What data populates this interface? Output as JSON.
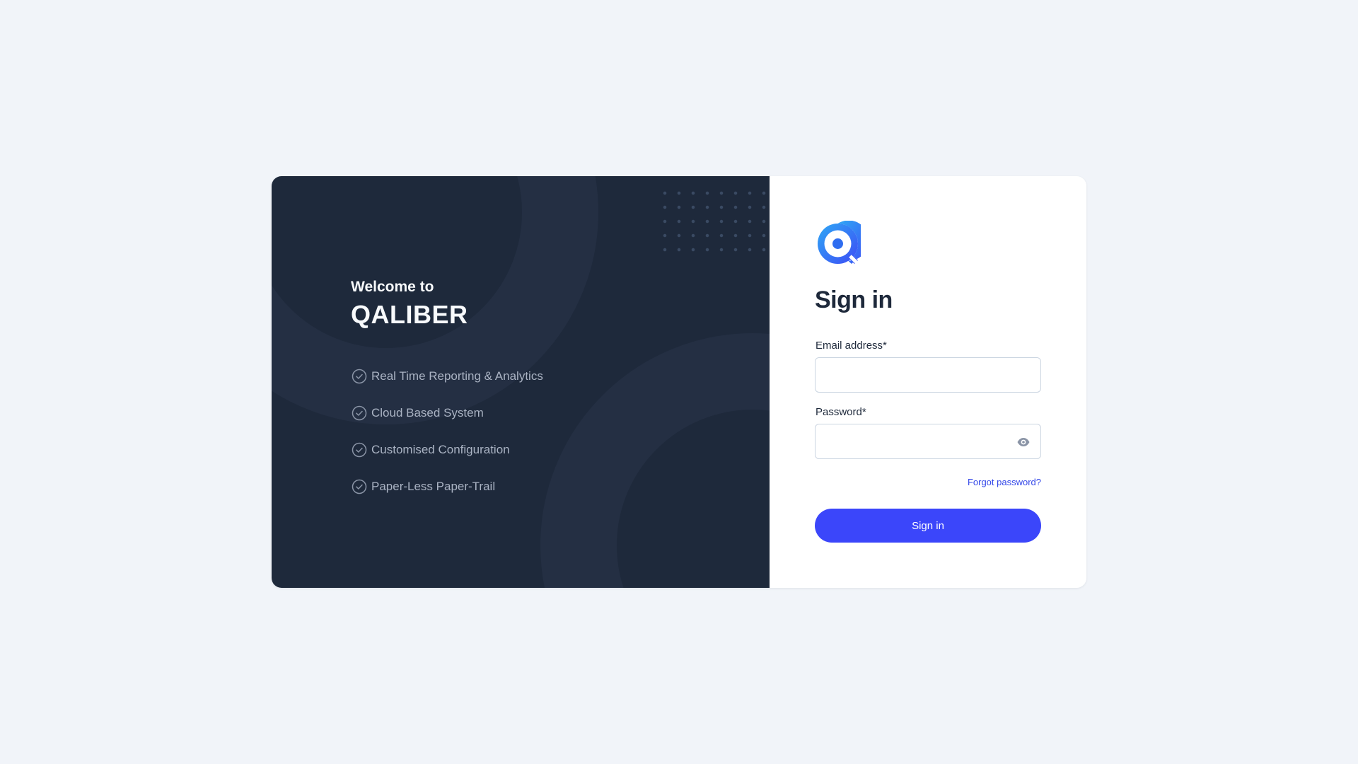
{
  "branding": {
    "welcome_subtitle": "Welcome to",
    "product_name": "QALIBER",
    "logo_icon": "qaliber-logo-icon"
  },
  "features": [
    {
      "label": "Real Time Reporting & Analytics",
      "icon": "check-circle-icon"
    },
    {
      "label": "Cloud Based System",
      "icon": "check-circle-icon"
    },
    {
      "label": "Customised Configuration",
      "icon": "check-circle-icon"
    },
    {
      "label": "Paper-Less Paper-Trail",
      "icon": "check-circle-icon"
    }
  ],
  "form": {
    "title": "Sign in",
    "email_label": "Email address*",
    "email_value": "",
    "password_label": "Password*",
    "password_value": "",
    "password_toggle_icon": "eye-icon",
    "forgot_link": "Forgot password?",
    "submit_label": "Sign in"
  },
  "colors": {
    "page_background": "#f1f4f9",
    "panel_dark": "#1e293b",
    "accent": "#3b46fa",
    "link": "#3347e8"
  }
}
